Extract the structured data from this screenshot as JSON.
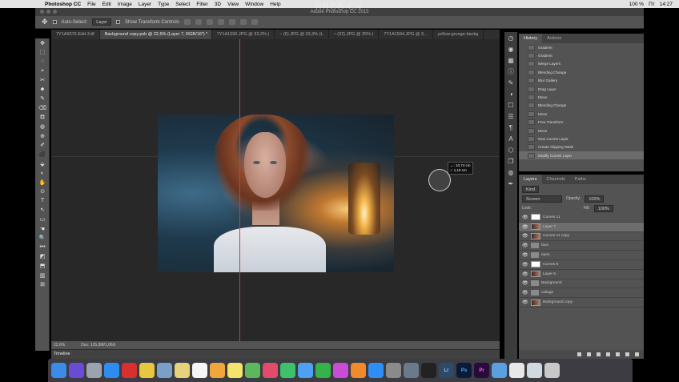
{
  "menubar": {
    "apple": "",
    "app": "Photoshop CC",
    "items": [
      "File",
      "Edit",
      "Image",
      "Layer",
      "Type",
      "Select",
      "Filter",
      "3D",
      "View",
      "Window",
      "Help"
    ],
    "battery": "100 %",
    "day": "Пт",
    "time": "14:27"
  },
  "window": {
    "title": "Adobe Photoshop CC 2015"
  },
  "options": {
    "auto_select": "Auto-Select:",
    "auto_select_value": "Layer",
    "transform": "Show Transform Controls"
  },
  "tabs": [
    {
      "label": "7Y1A9376-Edit-3.tif"
    },
    {
      "label": "Background copy.psb @ 22,6% (Layer 7, RGB/16*) *",
      "active": true
    },
    {
      "label": "7Y1A1596.JPG @ 33,3% ("
    },
    {
      "label": "~ (6).JPG @ 33,3% (L"
    },
    {
      "label": "~ (32).JPG @ 25% ("
    },
    {
      "label": "7Y1A1594.JPG @ 3..."
    },
    {
      "label": "yellow-grunge-backg"
    }
  ],
  "tools": [
    "✥",
    "⬚",
    "◌",
    "⌖",
    "✂",
    "⬥",
    "✎",
    "⌫",
    "⛾",
    "◍",
    "⊕",
    "✐",
    "⬛",
    "⬙",
    "◐",
    "✋",
    "⊙",
    "T",
    "↖",
    "▭",
    "☚",
    "🔍",
    "•••",
    "◩",
    "⬒",
    "▥",
    "⊞"
  ],
  "dimensions": {
    "w": "↔: 10,74 cm",
    "h": "↕: 1,19 cm"
  },
  "status": {
    "zoom": "22,6%",
    "doc": "Doc: 125,8M/1,06G"
  },
  "timeline": {
    "label": "Timeline"
  },
  "history": {
    "tab1": "History",
    "tab2": "Actions",
    "items": [
      "Gradient",
      "Gradient",
      "Merge Layers",
      "Blending Change",
      "Blur Gallery",
      "Drag Layer",
      "Move",
      "Blending Change",
      "Move",
      "Free Transform",
      "Move",
      "New Curves Layer",
      "Create Clipping Mask",
      "Modify Curves Layer"
    ]
  },
  "layers": {
    "tab1": "Layers",
    "tab2": "Channels",
    "tab3": "Paths",
    "kind": "Kind",
    "blend": "Screen",
    "opacity_label": "Opacity:",
    "opacity": "100%",
    "lock_label": "Lock:",
    "fill_label": "Fill:",
    "fill": "100%",
    "rows": [
      {
        "name": "Curves 11",
        "type": "adj"
      },
      {
        "name": "Layer 7",
        "type": "pix",
        "sel": true
      },
      {
        "name": "Curves 11 copy",
        "type": "pix"
      },
      {
        "name": "face",
        "type": "folder"
      },
      {
        "name": "eyes",
        "type": "folder"
      },
      {
        "name": "Curves 8",
        "type": "adj"
      },
      {
        "name": "Layer 6",
        "type": "pix"
      },
      {
        "name": "Background",
        "type": "folder"
      },
      {
        "name": "collage",
        "type": "folder"
      },
      {
        "name": "Background copy",
        "type": "pix"
      }
    ]
  },
  "dock": [
    "Finder",
    "Siri",
    "Launchpad",
    "Safari",
    "Opera",
    "Chrome",
    "Preview",
    "Notes",
    "Calendar",
    "Photos",
    "Stickies",
    "Maps",
    "Music",
    "Messages",
    "Mail",
    "FaceTime",
    "iTunes",
    "iBooks",
    "App Store",
    "Settings",
    "Migration",
    "Clock",
    "Lr",
    "Ps",
    "Pr",
    "Folder",
    "Docs",
    "Images",
    "Trash"
  ],
  "watermark": "RRCG.CN"
}
